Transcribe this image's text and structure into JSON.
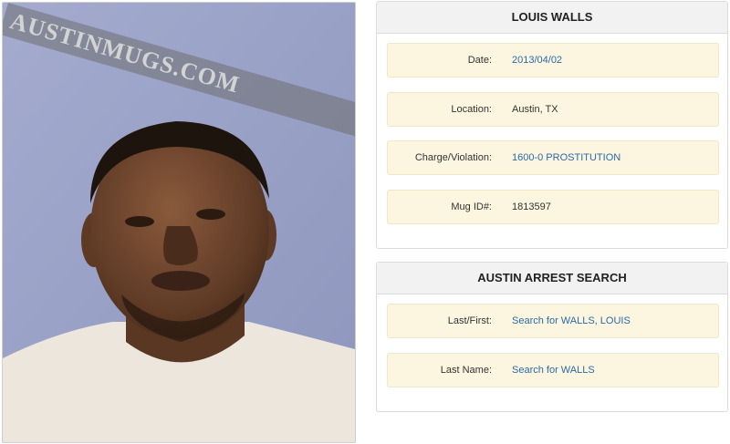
{
  "photo": {
    "watermark": "AUSTINMUGS.COM"
  },
  "arrest": {
    "title": "LOUIS WALLS",
    "rows": [
      {
        "label": "Date:",
        "value": "2013/04/02"
      },
      {
        "label": "Location:",
        "value": "Austin, TX"
      },
      {
        "label": "Charge/Violation:",
        "value": "1600-0 PROSTITUTION"
      },
      {
        "label": "Mug ID#:",
        "value": "1813597"
      }
    ]
  },
  "search": {
    "title": "AUSTIN ARREST SEARCH",
    "rows": [
      {
        "label": "Last/First:",
        "value": "Search for WALLS, LOUIS"
      },
      {
        "label": "Last Name:",
        "value": "Search for WALLS"
      }
    ]
  },
  "colors": {
    "link": "#2a6aa8",
    "row_bg": "#fcf6e0",
    "header_bg": "#f2f2f2",
    "wall": "#9aa2c6"
  }
}
